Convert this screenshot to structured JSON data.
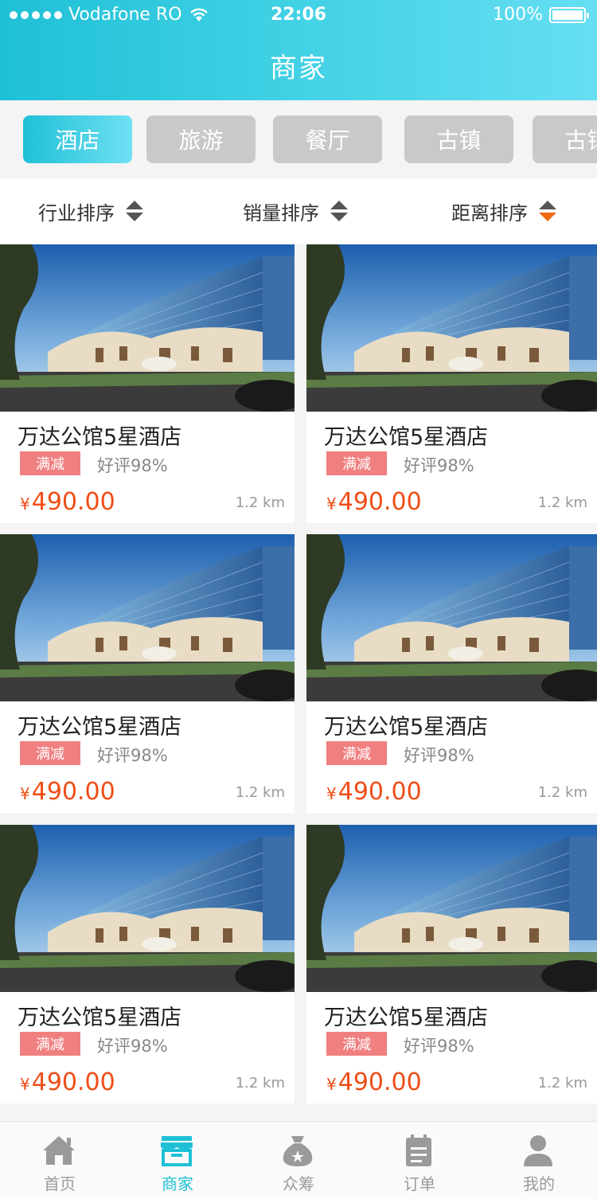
{
  "status_bar": {
    "carrier": "Vodafone RO",
    "time": "22:06",
    "battery": "100%"
  },
  "header": {
    "title": "商家"
  },
  "categories": [
    {
      "label": "酒店",
      "active": true
    },
    {
      "label": "旅游",
      "active": false
    },
    {
      "label": "餐厅",
      "active": false
    },
    {
      "label": "古镇",
      "active": false
    },
    {
      "label": "古镇",
      "active": false
    }
  ],
  "sort": [
    {
      "label": "行业排序",
      "state": "none"
    },
    {
      "label": "销量排序",
      "state": "none"
    },
    {
      "label": "距离排序",
      "state": "descending"
    }
  ],
  "listings": [
    {
      "name": "万达公馆5星酒店",
      "badge": "满减",
      "rating": "好评98%",
      "currency": "¥",
      "price": "490.00",
      "distance": "1.2 km"
    },
    {
      "name": "万达公馆5星酒店",
      "badge": "满减",
      "rating": "好评98%",
      "currency": "¥",
      "price": "490.00",
      "distance": "1.2 km"
    },
    {
      "name": "万达公馆5星酒店",
      "badge": "满减",
      "rating": "好评98%",
      "currency": "¥",
      "price": "490.00",
      "distance": "1.2 km"
    },
    {
      "name": "万达公馆5星酒店",
      "badge": "满减",
      "rating": "好评98%",
      "currency": "¥",
      "price": "490.00",
      "distance": "1.2 km"
    },
    {
      "name": "万达公馆5星酒店",
      "badge": "满减",
      "rating": "好评98%",
      "currency": "¥",
      "price": "490.00",
      "distance": "1.2 km"
    },
    {
      "name": "万达公馆5星酒店",
      "badge": "满减",
      "rating": "好评98%",
      "currency": "¥",
      "price": "490.00",
      "distance": "1.2 km"
    }
  ],
  "bottom_nav": [
    {
      "label": "首页",
      "icon": "home-icon",
      "active": false
    },
    {
      "label": "商家",
      "icon": "store-icon",
      "active": true
    },
    {
      "label": "众筹",
      "icon": "crowdfund-bag-icon",
      "active": false
    },
    {
      "label": "订单",
      "icon": "order-clipboard-icon",
      "active": false
    },
    {
      "label": "我的",
      "icon": "profile-icon",
      "active": false
    }
  ],
  "colors": {
    "accent": "#1fc0d6",
    "price": "#ef4d16",
    "badge": "#f07f7f",
    "sort_active": "#f06a14"
  }
}
